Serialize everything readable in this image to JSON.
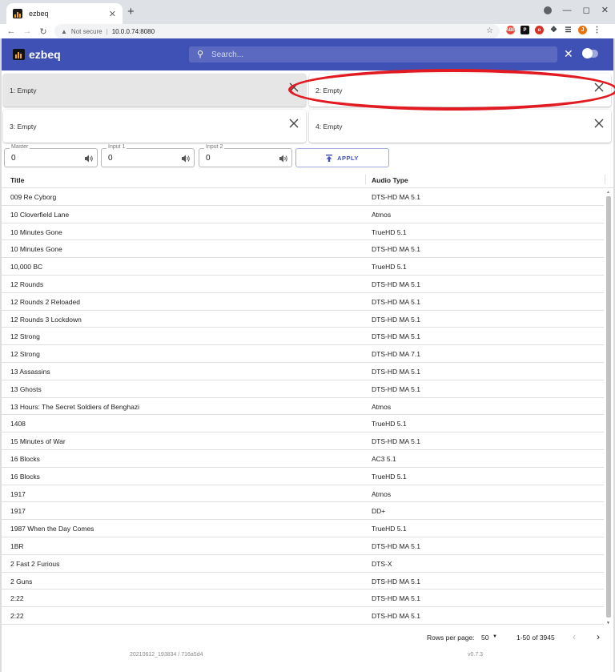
{
  "browser": {
    "tab_title": "ezbeq",
    "tab_close": "✕",
    "new_tab": "+",
    "security": "Not secure",
    "url": "10.0.0.74:8080",
    "profile_initial": "J"
  },
  "app": {
    "name": "ezbeq",
    "search_placeholder": "Search...",
    "brand_color": "#3f51b5"
  },
  "slots": [
    {
      "label": "1: Empty",
      "active": true
    },
    {
      "label": "2: Empty",
      "active": false
    },
    {
      "label": "3: Empty",
      "active": false
    },
    {
      "label": "4: Empty",
      "active": false
    }
  ],
  "volume": {
    "master": {
      "label": "Master",
      "value": "0"
    },
    "input1": {
      "label": "Input 1",
      "value": "0"
    },
    "input2": {
      "label": "Input 2",
      "value": "0"
    },
    "apply_label": "APPLY"
  },
  "table": {
    "columns": [
      "Title",
      "Audio Type"
    ],
    "rows": [
      [
        "009 Re Cyborg",
        "DTS-HD MA 5.1"
      ],
      [
        "10 Cloverfield Lane",
        "Atmos"
      ],
      [
        "10 Minutes Gone",
        "TrueHD 5.1"
      ],
      [
        "10 Minutes Gone",
        "DTS-HD MA 5.1"
      ],
      [
        "10,000 BC",
        "TrueHD 5.1"
      ],
      [
        "12 Rounds",
        "DTS-HD MA 5.1"
      ],
      [
        "12 Rounds 2 Reloaded",
        "DTS-HD MA 5.1"
      ],
      [
        "12 Rounds 3 Lockdown",
        "DTS-HD MA 5.1"
      ],
      [
        "12 Strong",
        "DTS-HD MA 5.1"
      ],
      [
        "12 Strong",
        "DTS-HD MA 7.1"
      ],
      [
        "13 Assassins",
        "DTS-HD MA 5.1"
      ],
      [
        "13 Ghosts",
        "DTS-HD MA 5.1"
      ],
      [
        "13 Hours: The Secret Soldiers of Benghazi",
        "Atmos"
      ],
      [
        "1408",
        "TrueHD 5.1"
      ],
      [
        "15 Minutes of War",
        "DTS-HD MA 5.1"
      ],
      [
        "16 Blocks",
        "AC3 5.1"
      ],
      [
        "16 Blocks",
        "TrueHD 5.1"
      ],
      [
        "1917",
        "Atmos"
      ],
      [
        "1917",
        "DD+"
      ],
      [
        "1987 When the Day Comes",
        "TrueHD 5.1"
      ],
      [
        "1BR",
        "DTS-HD MA 5.1"
      ],
      [
        "2 Fast 2 Furious",
        "DTS-X"
      ],
      [
        "2 Guns",
        "DTS-HD MA 5.1"
      ],
      [
        "2:22",
        "DTS-HD MA 5.1"
      ],
      [
        "2:22",
        "DTS-HD MA 5.1"
      ]
    ]
  },
  "pagination": {
    "rows_per_page_label": "Rows per page:",
    "rows_per_page": "50",
    "range": "1-50 of 3945"
  },
  "footer": {
    "build": "20210612_193834 / 716a5d4",
    "version": "v0.7.3"
  },
  "annotation": {
    "color": "#e21b23"
  }
}
